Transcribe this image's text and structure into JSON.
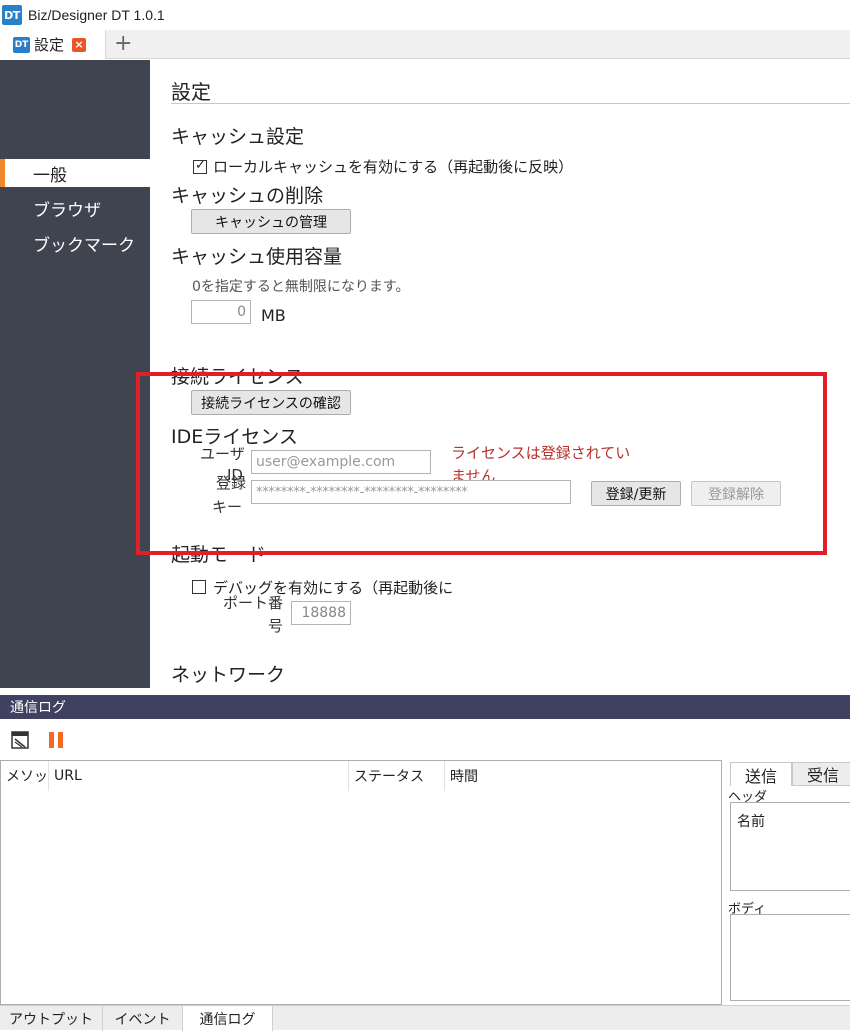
{
  "app": {
    "logo": "DT",
    "title": "Biz/Designer DT 1.0.1"
  },
  "tabs": [
    {
      "logo": "DT",
      "label": "設定",
      "close_icon": "close-icon",
      "add_icon": "plus-icon"
    }
  ],
  "tab_add_glyph": "+",
  "tab_close_glyph": "×",
  "sidebar": {
    "items": [
      {
        "label": "一般",
        "active": true
      },
      {
        "label": "ブラウザ"
      },
      {
        "label": "ブックマーク"
      }
    ]
  },
  "settings": {
    "title": "設定",
    "cache": {
      "heading": "キャッシュ設定",
      "enable_local_cache_label": "ローカルキャッシュを有効にする（再起動後に反映）",
      "enable_local_cache_checked": true,
      "delete_heading": "キャッシュの削除",
      "manage_button": "キャッシュの管理",
      "usage_heading": "キャッシュ使用容量",
      "usage_hint": "0を指定すると無制限になります。",
      "usage_value": "0",
      "usage_unit": "MB"
    },
    "connection_license": {
      "heading": "接続ライセンス",
      "check_button": "接続ライセンスの確認"
    },
    "ide_license": {
      "heading": "IDEライセンス",
      "user_id_label_1": "ユーザ",
      "user_id_label_2": "ID",
      "user_id_placeholder": "user@example.com",
      "key_label_1": "登録",
      "key_label_2": "キー",
      "key_placeholder": "********-********-********-********",
      "status_line1": "ライセンスは登録されてい",
      "status_line2": "ません",
      "register_button": "登録/更新",
      "unregister_button": "登録解除"
    },
    "startup_mode": {
      "heading": "起動モード",
      "debug_label": "デバッグを有効にする（再起動後に",
      "debug_checked": false,
      "port_label_1": "ポート番",
      "port_label_2": "号",
      "port_value": "18888"
    },
    "network": {
      "heading": "ネットワーク"
    }
  },
  "bottom_panel": {
    "title": "通信ログ",
    "toolbar": {
      "clear_icon": "clear-log-icon",
      "pause_icon": "pause-icon"
    },
    "columns": [
      "メソッド",
      "URL",
      "ステータス",
      "時間"
    ],
    "detail": {
      "tabs": [
        "送信",
        "受信"
      ],
      "active_tab": "送信",
      "header_label": "ヘッダ",
      "header_column": "名前",
      "body_label": "ボディ"
    },
    "tabs": [
      "アウトプット",
      "イベント",
      "通信ログ"
    ],
    "active_tab": "通信ログ"
  },
  "colors": {
    "sidebar_bg": "#404450",
    "accent": "#f0882b",
    "highlight": "#e02028",
    "error_text": "#b8302a",
    "panel_title_bg": "#404060"
  }
}
